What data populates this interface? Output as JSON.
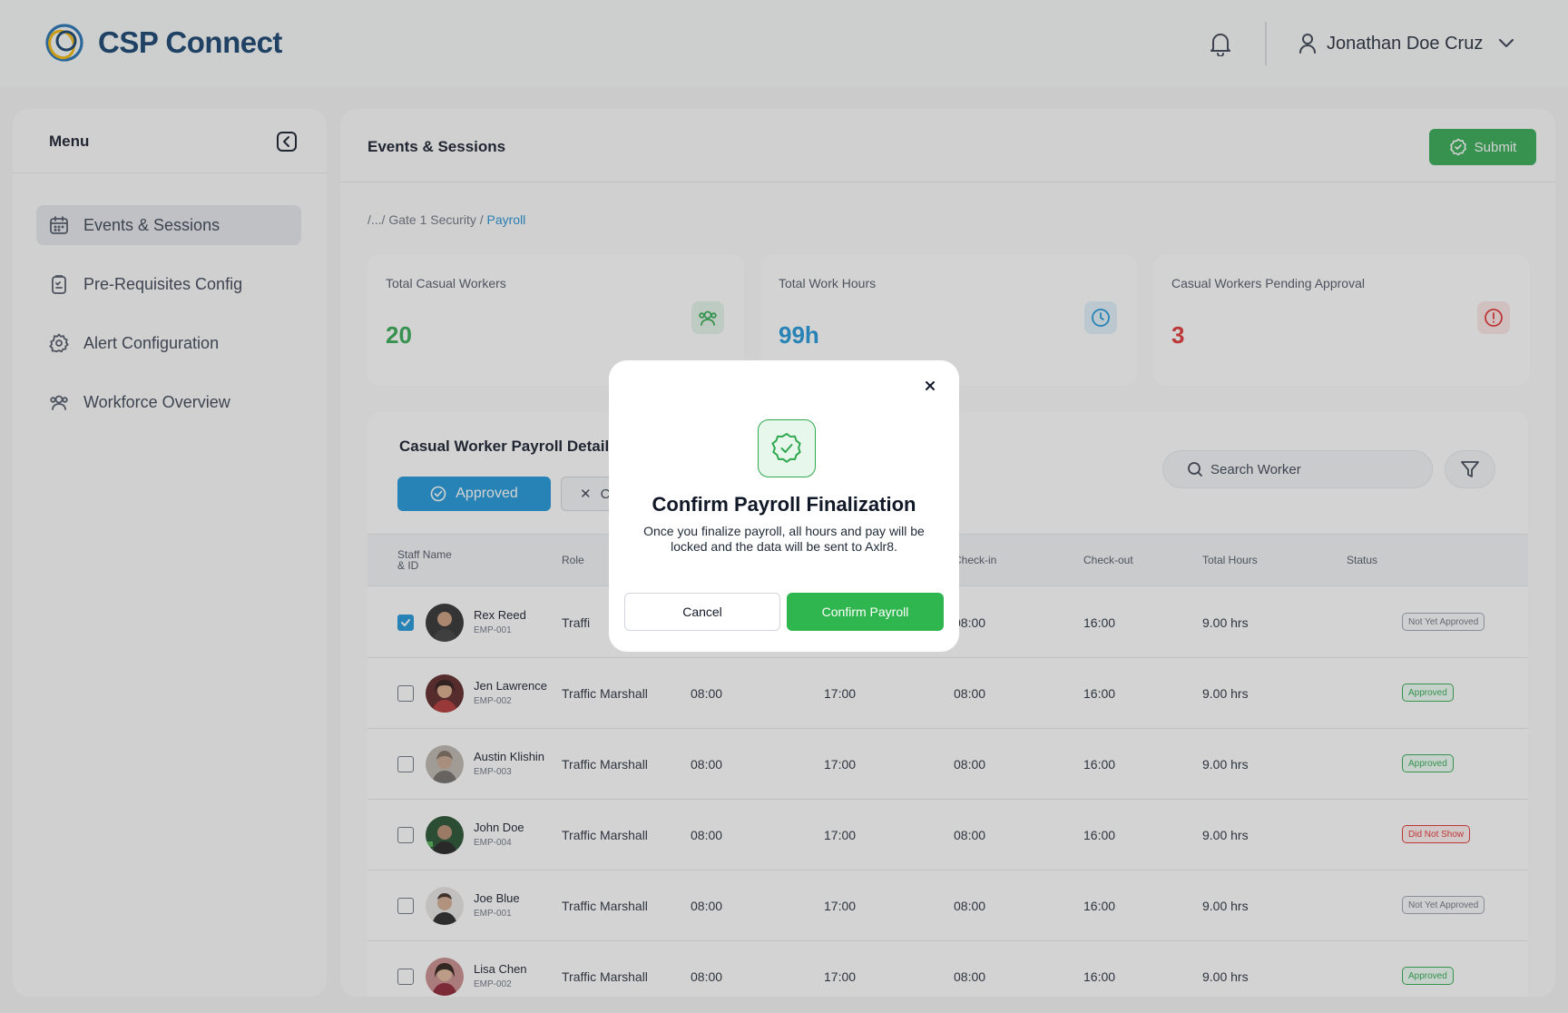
{
  "header": {
    "brand": "CSP Connect",
    "user_name": "Jonathan Doe Cruz"
  },
  "sidebar": {
    "title": "Menu",
    "items": [
      {
        "label": "Events & Sessions",
        "icon": "calendar-icon",
        "active": true
      },
      {
        "label": "Pre-Requisites Config",
        "icon": "clipboard-icon",
        "active": false
      },
      {
        "label": "Alert Configuration",
        "icon": "gear-icon",
        "active": false
      },
      {
        "label": "Workforce Overview",
        "icon": "users-icon",
        "active": false
      }
    ]
  },
  "main": {
    "title": "Events & Sessions",
    "submit_label": "Submit",
    "breadcrumb": {
      "prefix": "/.../ Gate 1 Security / ",
      "current": "Payroll"
    },
    "stats": [
      {
        "label": "Total Casual Workers",
        "value": "20",
        "color": "#2fa84f",
        "icon": "users-icon"
      },
      {
        "label": "Total Work Hours",
        "value": "99h",
        "color": "#1a95d8",
        "icon": "clock-icon"
      },
      {
        "label": "Casual Workers Pending Approval",
        "value": "3",
        "color": "#e03131",
        "icon": "alert-icon"
      }
    ],
    "table": {
      "title": "Casual Worker Payroll Details",
      "tabs": {
        "approved": "Approved",
        "other": "C"
      },
      "search_placeholder": "Search Worker",
      "columns": {
        "staff_line1": "Staff Name",
        "staff_line2": "& ID",
        "role": "Role",
        "checkin": "Check-in",
        "checkout": "Check-out",
        "total": "Total Hours",
        "status": "Status"
      },
      "rows": [
        {
          "name": "Rex Reed",
          "id": "EMP-001",
          "role": "Traffi",
          "start": "",
          "end": "",
          "checkin": "08:00",
          "checkout": "16:00",
          "hours": "9.00 hrs",
          "status": "Not Yet Approved",
          "checked": true
        },
        {
          "name": "Jen Lawrence",
          "id": "EMP-002",
          "role": "Traffic Marshall",
          "start": "08:00",
          "end": "17:00",
          "checkin": "08:00",
          "checkout": "16:00",
          "hours": "9.00 hrs",
          "status": "Approved",
          "checked": false
        },
        {
          "name": "Austin Klishin",
          "id": "EMP-003",
          "role": "Traffic Marshall",
          "start": "08:00",
          "end": "17:00",
          "checkin": "08:00",
          "checkout": "16:00",
          "hours": "9.00 hrs",
          "status": "Approved",
          "checked": false
        },
        {
          "name": "John Doe",
          "id": "EMP-004",
          "role": "Traffic Marshall",
          "start": "08:00",
          "end": "17:00",
          "checkin": "08:00",
          "checkout": "16:00",
          "hours": "9.00 hrs",
          "status": "Did Not Show",
          "checked": false
        },
        {
          "name": "Joe Blue",
          "id": "EMP-001",
          "role": "Traffic Marshall",
          "start": "08:00",
          "end": "17:00",
          "checkin": "08:00",
          "checkout": "16:00",
          "hours": "9.00 hrs",
          "status": "Not Yet Approved",
          "checked": false
        },
        {
          "name": "Lisa Chen",
          "id": "EMP-002",
          "role": "Traffic Marshall",
          "start": "08:00",
          "end": "17:00",
          "checkin": "08:00",
          "checkout": "16:00",
          "hours": "9.00 hrs",
          "status": "Approved",
          "checked": false
        }
      ]
    }
  },
  "modal": {
    "title": "Confirm Payroll Finalization",
    "text": "Once you finalize payroll, all hours and pay will be locked and the data will be sent to Axlr8.",
    "cancel_label": "Cancel",
    "confirm_label": "Confirm Payroll"
  },
  "colors": {
    "brand": "#0e3d6b",
    "accent_blue": "#1a95d8",
    "accent_green": "#2fa84f",
    "danger": "#e03131"
  }
}
